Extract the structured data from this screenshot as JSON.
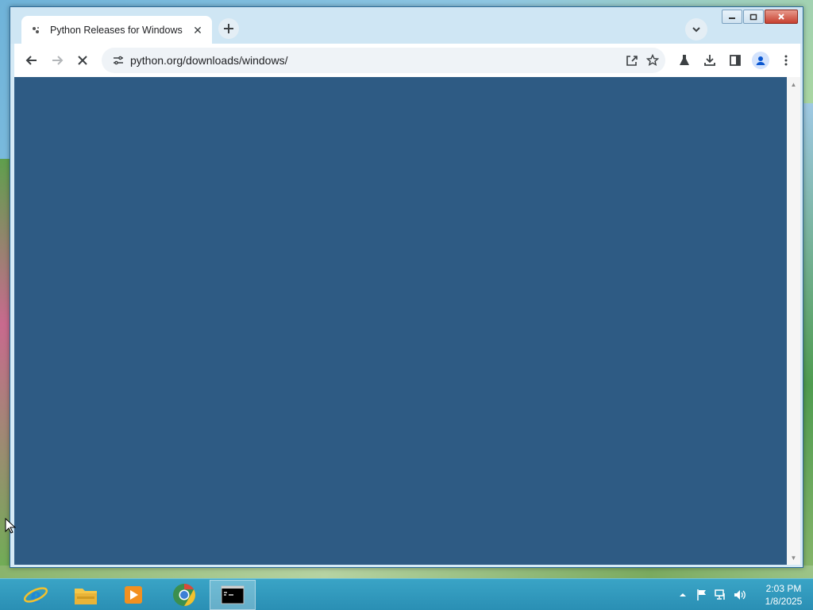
{
  "browser": {
    "tab": {
      "title": "Python Releases for Windows | Python.org",
      "favicon": "python-favicon-icon"
    },
    "url": "python.org/downloads/windows/",
    "toolbar_icons": [
      "back-arrow-icon",
      "forward-arrow-icon",
      "stop-loading-icon",
      "site-info-icon",
      "share-icon",
      "bookmark-star-icon",
      "labs-flask-icon",
      "download-icon",
      "side-panel-icon",
      "profile-icon",
      "menu-dots-icon"
    ],
    "content_background": "#2e5b84"
  },
  "taskbar": {
    "apps": [
      "internet-explorer-icon",
      "file-explorer-icon",
      "media-player-icon",
      "chrome-icon",
      "command-prompt-icon"
    ],
    "active_app": "command-prompt-icon",
    "tray_icons": [
      "show-hidden-icons-icon",
      "action-center-flag-icon",
      "network-icon",
      "volume-icon"
    ],
    "clock": {
      "time": "2:03 PM",
      "date": "1/8/2025"
    }
  }
}
